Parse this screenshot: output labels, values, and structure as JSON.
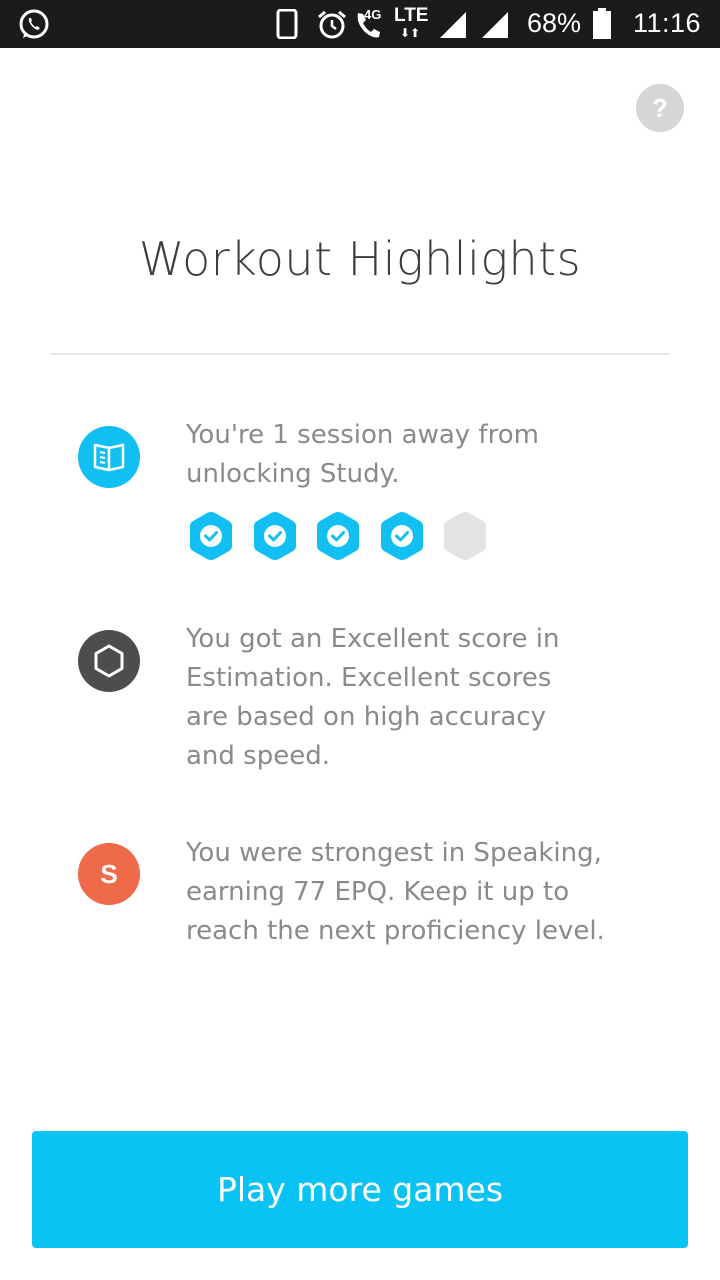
{
  "status_bar": {
    "network_4g": "4G",
    "network_lte": "LTE",
    "battery": "68%",
    "time": "11:16"
  },
  "help": {
    "label": "?"
  },
  "title": "Workout Highlights",
  "highlights": [
    {
      "icon": "study-book-icon",
      "color": "#12bff2",
      "lines": [
        "You're 1 session away from",
        "unlocking Study."
      ],
      "progress": {
        "completed": 4,
        "total": 5
      }
    },
    {
      "icon": "estimation-hexagon-icon",
      "color": "#4d4d4d",
      "lines": [
        "You got an Excellent score in",
        "Estimation. Excellent scores",
        "are based on high accuracy",
        "and speed."
      ]
    },
    {
      "icon": "speaking-icon",
      "icon_letter": "S",
      "color": "#ef6a48",
      "lines": [
        "You were strongest in Speaking,",
        "earning 77 EPQ. Keep it up to",
        "reach the next proficiency level."
      ]
    }
  ],
  "cta": {
    "label": "Play more games",
    "color": "#0ac3f5"
  }
}
